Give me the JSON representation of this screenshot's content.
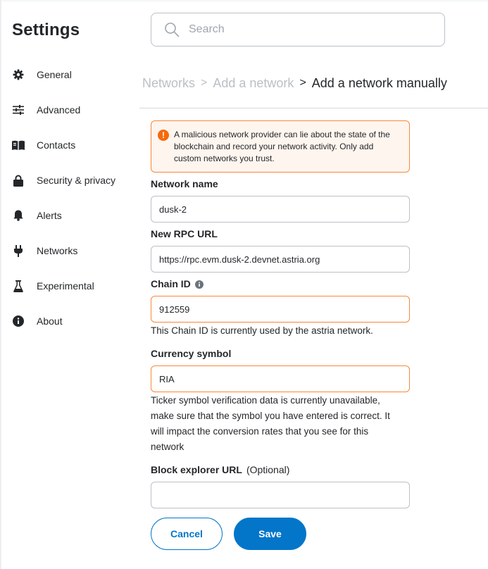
{
  "sidebar": {
    "title": "Settings",
    "items": [
      {
        "label": "General",
        "icon": "gear-icon"
      },
      {
        "label": "Advanced",
        "icon": "sliders-icon"
      },
      {
        "label": "Contacts",
        "icon": "book-icon"
      },
      {
        "label": "Security & privacy",
        "icon": "lock-icon"
      },
      {
        "label": "Alerts",
        "icon": "bell-icon"
      },
      {
        "label": "Networks",
        "icon": "plug-icon"
      },
      {
        "label": "Experimental",
        "icon": "flask-icon"
      },
      {
        "label": "About",
        "icon": "info-icon"
      }
    ]
  },
  "search": {
    "placeholder": "Search",
    "value": ""
  },
  "breadcrumb": {
    "level1": "Networks",
    "level2": "Add a network",
    "current": "Add a network manually",
    "separator": ">"
  },
  "warning": {
    "icon": "!",
    "text": "A malicious network provider can lie about the state of the blockchain and record your network activity. Only add custom networks you trust."
  },
  "form": {
    "network_name": {
      "label": "Network name",
      "value": "dusk-2"
    },
    "rpc_url": {
      "label": "New RPC URL",
      "value": "https://rpc.evm.dusk-2.devnet.astria.org"
    },
    "chain_id": {
      "label": "Chain ID",
      "value": "912559",
      "help": "This Chain ID is currently used by the astria network."
    },
    "currency_symbol": {
      "label": "Currency symbol",
      "value": "RIA",
      "help": "Ticker symbol verification data is currently unavailable, make sure that the symbol you have entered is correct. It will impact the conversion rates that you see for this network"
    },
    "block_explorer": {
      "label": "Block explorer URL",
      "optional": "(Optional)",
      "value": ""
    }
  },
  "actions": {
    "cancel_label": "Cancel",
    "save_label": "Save"
  },
  "colors": {
    "accent": "#0376c9",
    "warning": "#f8883b",
    "warning_bg": "#fef5ef",
    "text": "#24272a",
    "muted": "#bbc0c5"
  }
}
